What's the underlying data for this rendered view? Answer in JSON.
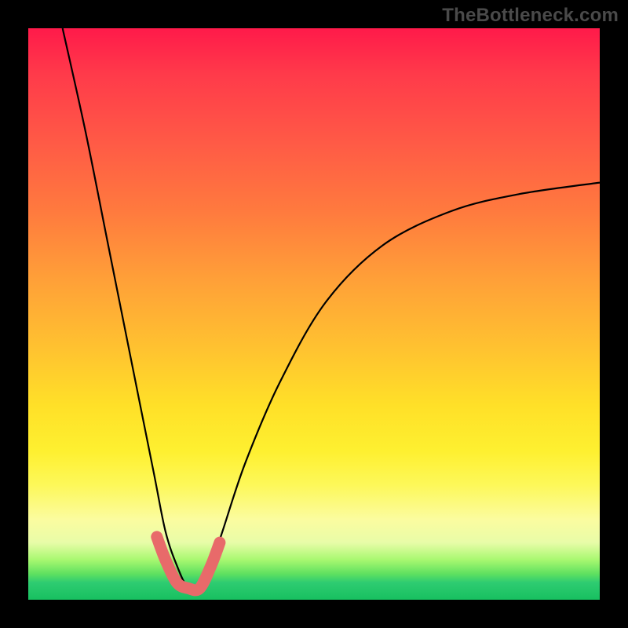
{
  "watermark": {
    "text": "TheBottleneck.com"
  },
  "chart_data": {
    "type": "line",
    "title": "",
    "xlabel": "",
    "ylabel": "",
    "xlim": [
      0,
      100
    ],
    "ylim": [
      0,
      100
    ],
    "grid": false,
    "legend": false,
    "series": [
      {
        "name": "bottleneck-curve",
        "note": "V-shaped curve: steep descent from top-left, minimum near x≈28 y≈2, rising to right edge near y≈73. Values estimated from pixel positions; chart has no numeric axes.",
        "x": [
          6,
          10,
          14,
          18,
          22,
          24,
          26,
          28,
          30,
          32,
          34,
          38,
          44,
          52,
          62,
          74,
          86,
          100
        ],
        "y": [
          100,
          82,
          62,
          42,
          22,
          12,
          6,
          2,
          2,
          6,
          12,
          24,
          38,
          52,
          62,
          68,
          71,
          73
        ]
      },
      {
        "name": "bottleneck-highlight",
        "note": "Thick salmon overlay highlighting the bottom of the V (near-minimum region).",
        "x": [
          22.5,
          24,
          26,
          28,
          30,
          32,
          33.5
        ],
        "y": [
          11,
          7,
          3,
          2,
          2,
          6,
          10
        ]
      }
    ]
  },
  "colors": {
    "curve": "#000000",
    "highlight": "#e86a6a"
  }
}
